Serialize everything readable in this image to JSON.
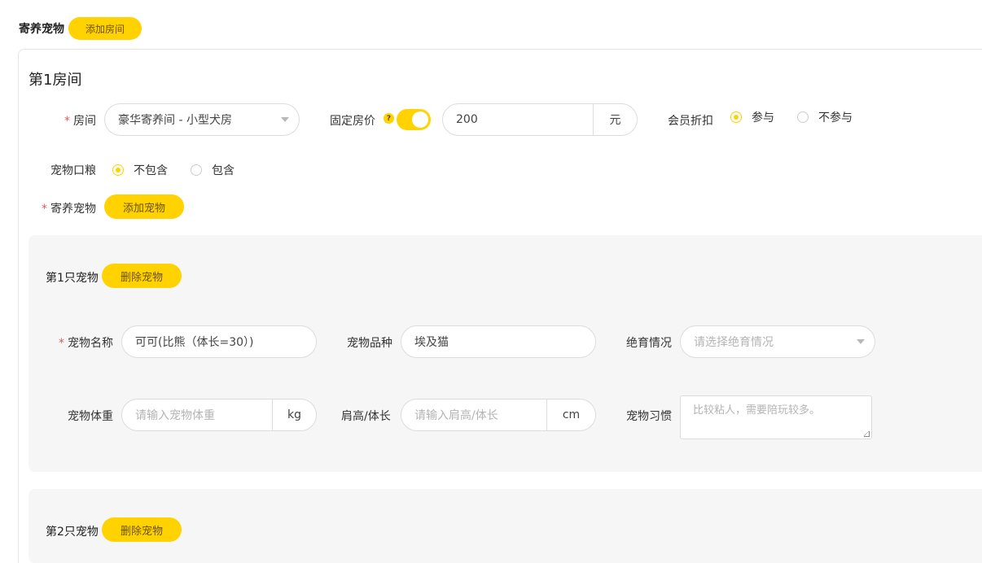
{
  "header": {
    "title": "寄养宠物",
    "add_room_label": "添加房间"
  },
  "room": {
    "title": "第1房间",
    "room_label": "房间",
    "room_value": "豪华寄养间 - 小型犬房",
    "fixed_price_label": "固定房价",
    "fixed_price_help": "?",
    "fixed_price_enabled": true,
    "price_value": "200",
    "price_unit": "元",
    "member_discount_label": "会员折扣",
    "member_discount_options": [
      "参与",
      "不参与"
    ],
    "member_discount_selected": "参与",
    "food_label": "宠物口粮",
    "food_options": [
      "不包含",
      "包含"
    ],
    "food_selected": "不包含",
    "pets_label": "寄养宠物",
    "add_pet_label": "添加宠物",
    "required_mark": "*"
  },
  "pets": [
    {
      "title": "第1只宠物",
      "delete_label": "删除宠物",
      "name_label": "宠物名称",
      "name_value": "可可(比熊（体长=30）)",
      "breed_label": "宠物品种",
      "breed_value": "埃及猫",
      "neuter_label": "绝育情况",
      "neuter_placeholder": "请选择绝育情况",
      "weight_label": "宠物体重",
      "weight_placeholder": "请输入宠物体重",
      "weight_unit": "kg",
      "size_label": "肩高/体长",
      "size_placeholder": "请输入肩高/体长",
      "size_unit": "cm",
      "habit_label": "宠物习惯",
      "habit_placeholder": "比较粘人，需要陪玩较多。"
    },
    {
      "title": "第2只宠物",
      "delete_label": "删除宠物"
    }
  ],
  "colors": {
    "accent": "#ffd200",
    "required": "#e05a5a",
    "card_bg": "#f6f6f6"
  }
}
